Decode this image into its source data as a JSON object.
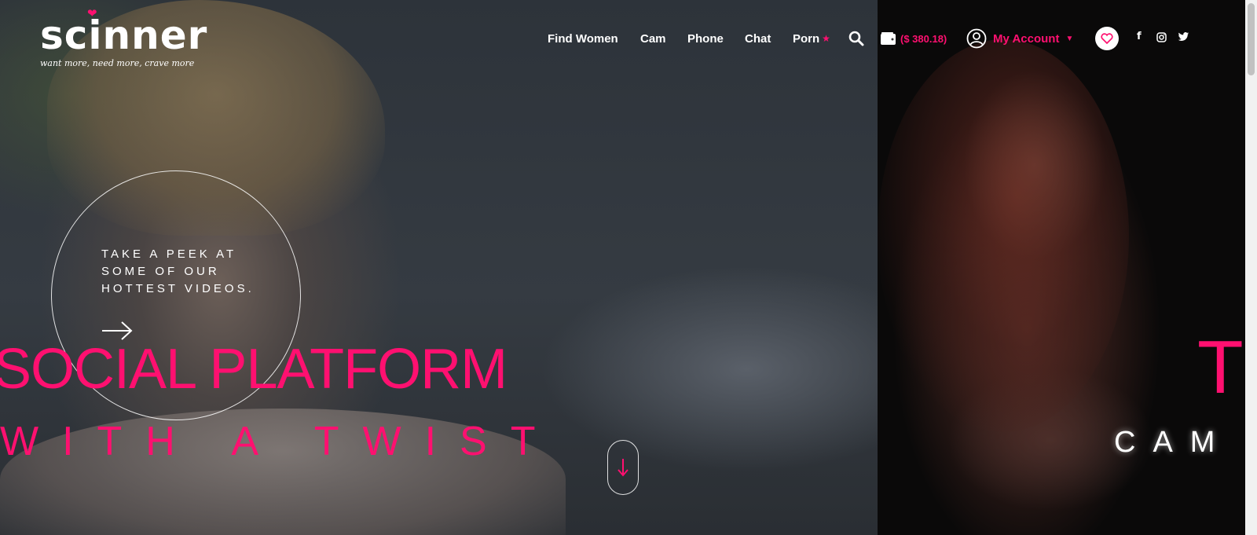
{
  "brand": {
    "name": "scinner",
    "tagline": "want more, need more, crave more",
    "accent_color": "#ff1070"
  },
  "nav": {
    "items": [
      {
        "label": "Find Women"
      },
      {
        "label": "Cam"
      },
      {
        "label": "Phone"
      },
      {
        "label": "Chat"
      },
      {
        "label": "Porn"
      }
    ],
    "search_icon": "search-icon",
    "wallet": {
      "icon": "wallet-icon",
      "balance": "($ 380.18)"
    },
    "account": {
      "icon": "user-circle-icon",
      "label": "My Account"
    },
    "favorites_icon": "heart-icon",
    "social": [
      {
        "icon": "facebook-icon",
        "glyph": "f"
      },
      {
        "icon": "instagram-icon"
      },
      {
        "icon": "twitter-icon"
      }
    ]
  },
  "hero": {
    "peek_text": "TAKE A PEEK AT SOME OF OUR HOTTEST VIDEOS.",
    "headline_line1": "SOCIAL PLATFORM",
    "headline_line2": "WITH A TWIST",
    "next_slide_partial_letter": "T",
    "next_slide_word": "CAM"
  }
}
